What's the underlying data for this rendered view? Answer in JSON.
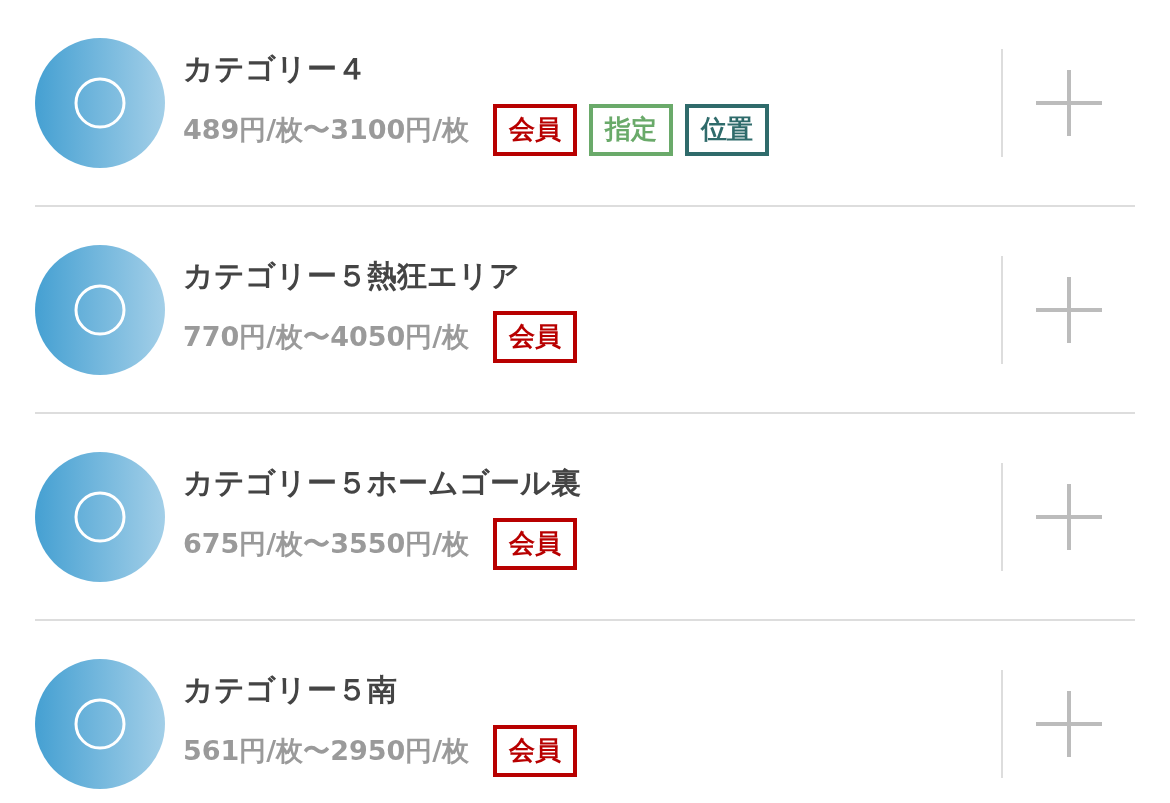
{
  "items": [
    {
      "name": "カテゴリー４",
      "price": "489円/枚〜3100円/枚",
      "badges": [
        {
          "label": "会員",
          "color": "#b80000"
        },
        {
          "label": "指定",
          "color": "#6aaa6a"
        },
        {
          "label": "位置",
          "color": "#2f6b6b"
        }
      ]
    },
    {
      "name": "カテゴリー５熱狂エリア",
      "price": "770円/枚〜4050円/枚",
      "badges": [
        {
          "label": "会員",
          "color": "#b80000"
        }
      ]
    },
    {
      "name": "カテゴリー５ホームゴール裏",
      "price": "675円/枚〜3550円/枚",
      "badges": [
        {
          "label": "会員",
          "color": "#b80000"
        }
      ]
    },
    {
      "name": "カテゴリー５南",
      "price": "561円/枚〜2950円/枚",
      "badges": [
        {
          "label": "会員",
          "color": "#b80000"
        }
      ]
    }
  ]
}
